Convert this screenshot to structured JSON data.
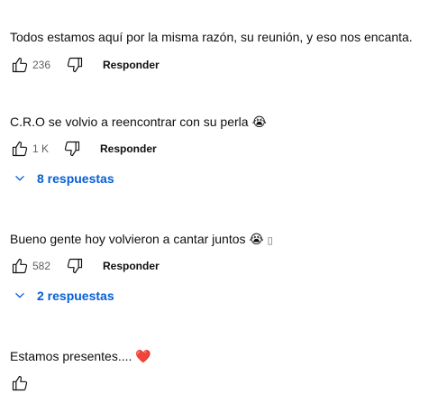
{
  "comments": [
    {
      "text": "Todos estamos aquí por la misma razón, su reunión, y eso nos encanta.",
      "likes": "236",
      "reply_label": "Responder",
      "replies": null
    },
    {
      "text": "C.R.O se volvio a reencontrar con su perla",
      "emoji": "😭",
      "likes": "1 K",
      "reply_label": "Responder",
      "replies": "8 respuestas"
    },
    {
      "text": "Bueno gente hoy volvieron a cantar juntos",
      "emoji": "😭",
      "emoji_extra": "▯",
      "likes": "582",
      "reply_label": "Responder",
      "replies": "2 respuestas"
    },
    {
      "text": "Estamos presentes....",
      "emoji": "❤️"
    }
  ],
  "icons": {
    "like": "thumbs-up-icon",
    "dislike": "thumbs-down-icon",
    "expand": "chevron-down-icon"
  },
  "colors": {
    "text": "#0f0f0f",
    "secondary": "#606060",
    "link": "#065fd4",
    "heart": "#e0245e"
  }
}
